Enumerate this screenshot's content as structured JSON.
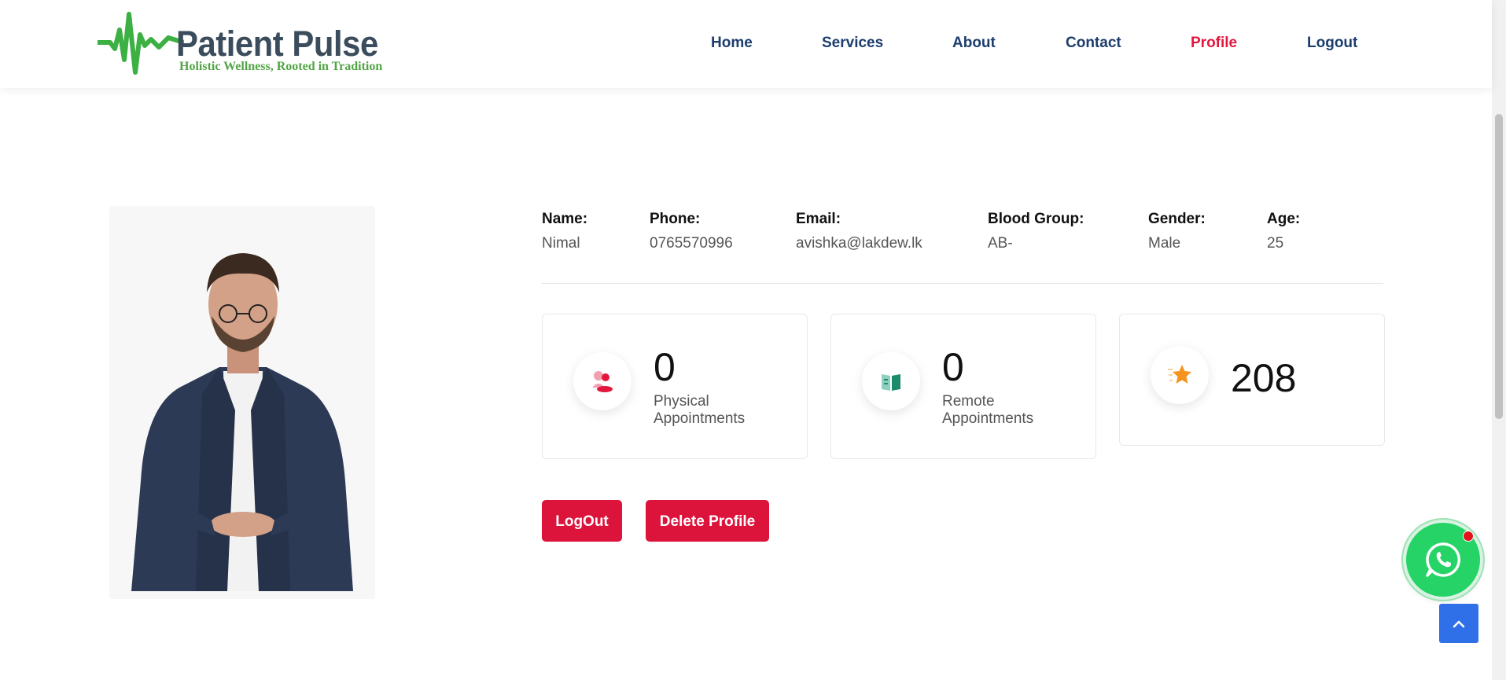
{
  "brand": {
    "name": "Patient Pulse",
    "tagline": "Holistic Wellness, Rooted in Tradition",
    "accent_green": "#3cb043",
    "text_color": "#3b4d5c"
  },
  "nav": {
    "items": [
      {
        "label": "Home",
        "active": false
      },
      {
        "label": "Services",
        "active": false
      },
      {
        "label": "About",
        "active": false
      },
      {
        "label": "Contact",
        "active": false
      },
      {
        "label": "Profile",
        "active": true
      },
      {
        "label": "Logout",
        "active": false
      }
    ],
    "color": "#1c3d6e",
    "active_color": "#e3173e"
  },
  "profile": {
    "fields": [
      {
        "label": "Name:",
        "value": "Nimal"
      },
      {
        "label": "Phone:",
        "value": "0765570996"
      },
      {
        "label": "Email:",
        "value": "avishka@lakdew.lk"
      },
      {
        "label": "Blood Group:",
        "value": "AB-"
      },
      {
        "label": "Gender:",
        "value": "Male"
      },
      {
        "label": "Age:",
        "value": "25"
      }
    ],
    "photo_icon": "user-photo"
  },
  "stats": [
    {
      "icon": "users-icon",
      "count": "0",
      "label_line1": "Physical",
      "label_line2": "Appointments"
    },
    {
      "icon": "book-icon",
      "count": "0",
      "label_line1": "Remote",
      "label_line2": "Appointments"
    },
    {
      "icon": "star-icon",
      "count": "208"
    }
  ],
  "actions": {
    "logout_label": "LogOut",
    "delete_label": "Delete Profile",
    "button_color": "#dc143c"
  },
  "floating": {
    "whatsapp_icon": "whatsapp-icon",
    "back_to_top_icon": "chevron-up-icon"
  }
}
